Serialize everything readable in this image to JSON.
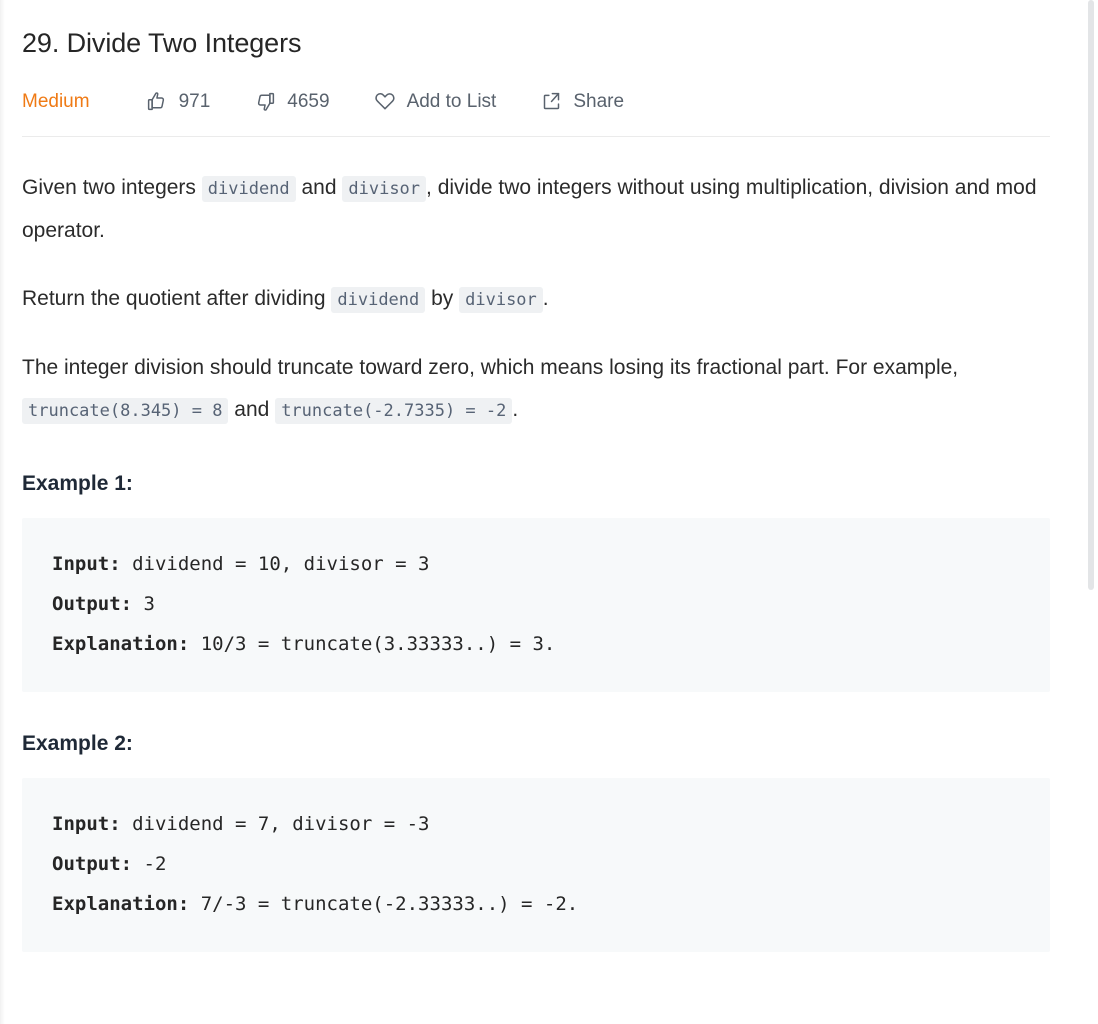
{
  "problem": {
    "title": "29. Divide Two Integers",
    "difficulty": "Medium",
    "difficulty_color": "#ef7a15"
  },
  "actions": {
    "likes": {
      "icon": "thumbs-up-icon",
      "count": "971"
    },
    "dislikes": {
      "icon": "thumbs-down-icon",
      "count": "4659"
    },
    "add_to_list": {
      "icon": "heart-icon",
      "label": "Add to List"
    },
    "share": {
      "icon": "share-icon",
      "label": "Share"
    }
  },
  "description": {
    "p1": {
      "t1": "Given two integers ",
      "c1": "dividend",
      "t2": " and ",
      "c2": "divisor",
      "t3": ", divide two integers without using multiplication, division and mod operator."
    },
    "p2": {
      "t1": "Return the quotient after dividing ",
      "c1": "dividend",
      "t2": " by ",
      "c2": "divisor",
      "t3": "."
    },
    "p3": {
      "t1": "The integer division should truncate toward zero, which means losing its fractional part. For example, ",
      "c1": "truncate(8.345) = 8",
      "t2": " and ",
      "c2": "truncate(-2.7335) = -2",
      "t3": "."
    }
  },
  "examples": [
    {
      "heading": "Example 1:",
      "input_label": "Input:",
      "input_value": " dividend = 10, divisor = 3",
      "output_label": "Output:",
      "output_value": " 3",
      "explanation_label": "Explanation:",
      "explanation_value": " 10/3 = truncate(3.33333..) = 3."
    },
    {
      "heading": "Example 2:",
      "input_label": "Input:",
      "input_value": " dividend = 7, divisor = -3",
      "output_label": "Output:",
      "output_value": " -2",
      "explanation_label": "Explanation:",
      "explanation_value": " 7/-3 = truncate(-2.33333..) = -2."
    }
  ],
  "scrollbar": {
    "name": "vertical-scrollbar"
  }
}
